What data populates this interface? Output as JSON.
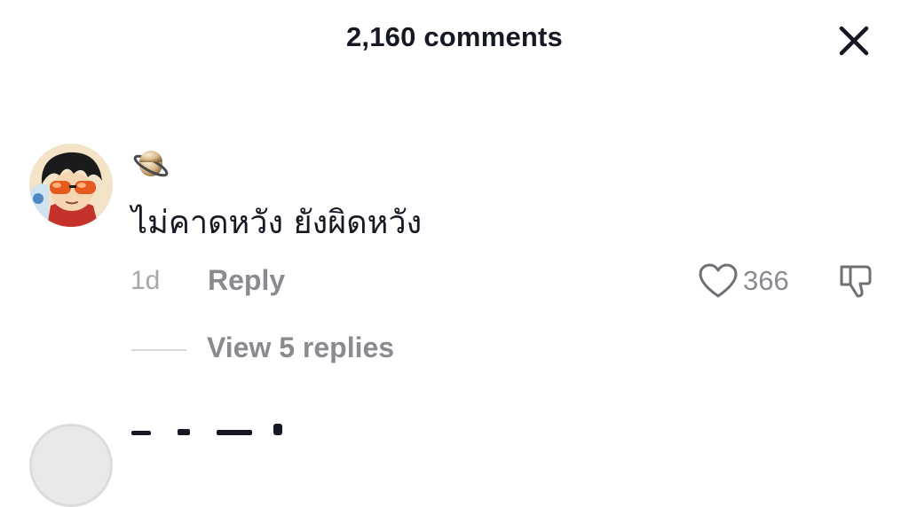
{
  "header": {
    "title": "2,160 comments",
    "close_icon": "close-icon"
  },
  "comment": {
    "author_emoji": "saturn-planet-emoji",
    "text": "ไม่คาดหวัง ยังผิดหวัง",
    "time": "1d",
    "reply_label": "Reply",
    "like_icon": "heart-outline-icon",
    "like_count": "366",
    "dislike_icon": "thumbs-down-icon",
    "view_replies_label": "View 5 replies"
  },
  "colors": {
    "primary_text": "#161823",
    "secondary_text": "#8a8b91",
    "muted_text": "#a7a8ad",
    "background": "#ffffff"
  }
}
